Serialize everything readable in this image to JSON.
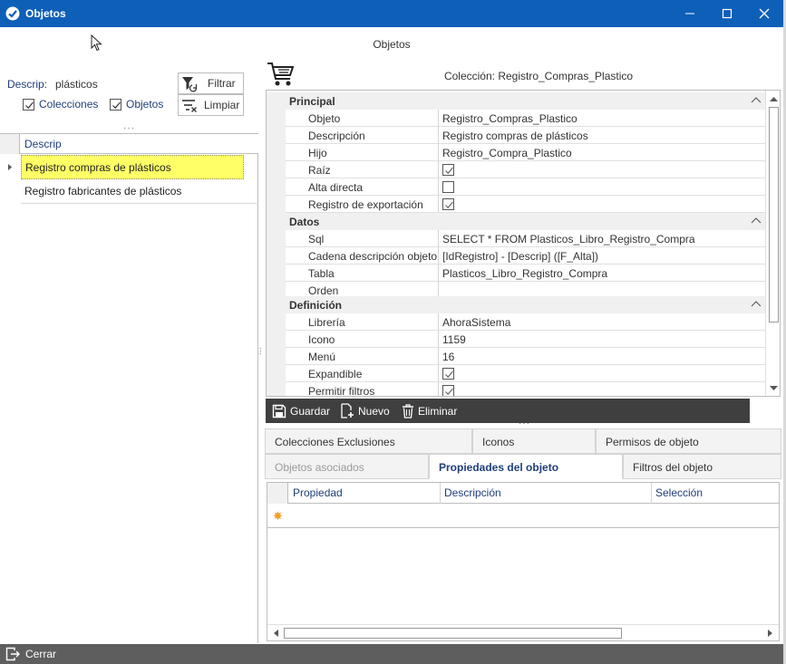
{
  "window": {
    "title": "Objetos",
    "minimize": "—",
    "maximize": "☐",
    "close": "✕"
  },
  "header": {
    "title": "Objetos"
  },
  "filter": {
    "descrip_label": "Descrip:",
    "descrip_value": "plásticos",
    "colecciones_label": "Colecciones",
    "colecciones_checked": true,
    "objetos_label": "Objetos",
    "objetos_checked": true,
    "filtrar_label": "Filtrar",
    "limpiar_label": "Limpiar"
  },
  "left_grid": {
    "column": "Descrip",
    "rows": [
      "Registro compras de plásticos",
      "Registro fabricantes de plásticos"
    ],
    "selected_index": 0
  },
  "collection": {
    "title": "Colección: Registro_Compras_Plastico"
  },
  "properties": {
    "categories": [
      {
        "name": "Principal",
        "rows": [
          {
            "name": "Objeto",
            "value": "Registro_Compras_Plastico",
            "type": "text"
          },
          {
            "name": "Descripción",
            "value": "Registro compras de plásticos",
            "type": "text"
          },
          {
            "name": "Hijo",
            "value": "Registro_Compra_Plastico",
            "type": "text"
          },
          {
            "name": "Raíz",
            "checked": true,
            "type": "check"
          },
          {
            "name": "Alta directa",
            "checked": false,
            "type": "check"
          },
          {
            "name": "Registro de exportación",
            "checked": true,
            "type": "check"
          }
        ]
      },
      {
        "name": "Datos",
        "rows": [
          {
            "name": "Sql",
            "value": "SELECT * FROM Plasticos_Libro_Registro_Compra",
            "type": "text"
          },
          {
            "name": "Cadena descripción objeto",
            "value": "[IdRegistro] - [Descrip] ([F_Alta])",
            "type": "text"
          },
          {
            "name": "Tabla",
            "value": "Plasticos_Libro_Registro_Compra",
            "type": "text"
          },
          {
            "name": "Orden",
            "value": "",
            "type": "text"
          }
        ]
      },
      {
        "name": "Definición",
        "rows": [
          {
            "name": "Librería",
            "value": "AhoraSistema",
            "type": "text"
          },
          {
            "name": "Icono",
            "value": "1159",
            "type": "text"
          },
          {
            "name": "Menú",
            "value": "16",
            "type": "text"
          },
          {
            "name": "Expandible",
            "checked": true,
            "type": "check"
          },
          {
            "name": "Permitir filtros",
            "checked": true,
            "type": "check"
          }
        ]
      }
    ]
  },
  "actions": {
    "guardar": "Guardar",
    "nuevo": "Nuevo",
    "eliminar": "Eliminar"
  },
  "tabs": {
    "row1": [
      "Colecciones Exclusiones",
      "Iconos",
      "Permisos de objeto"
    ],
    "row2": [
      "Objetos asociados",
      "Propiedades del objeto",
      "Filtros del objeto"
    ],
    "active": "Propiedades del objeto",
    "disabled": "Objetos asociados"
  },
  "sub_grid": {
    "columns": [
      "Propiedad",
      "Descripción",
      "Selección"
    ],
    "new_row_marker": "✸"
  },
  "footer": {
    "close_label": "Cerrar"
  },
  "colors": {
    "titlebar": "#0e5fb8",
    "selection": "#ffff66",
    "actionbar": "#3f3f3f",
    "footer": "#5e5e5e",
    "accent_text": "#1f3f7a"
  }
}
